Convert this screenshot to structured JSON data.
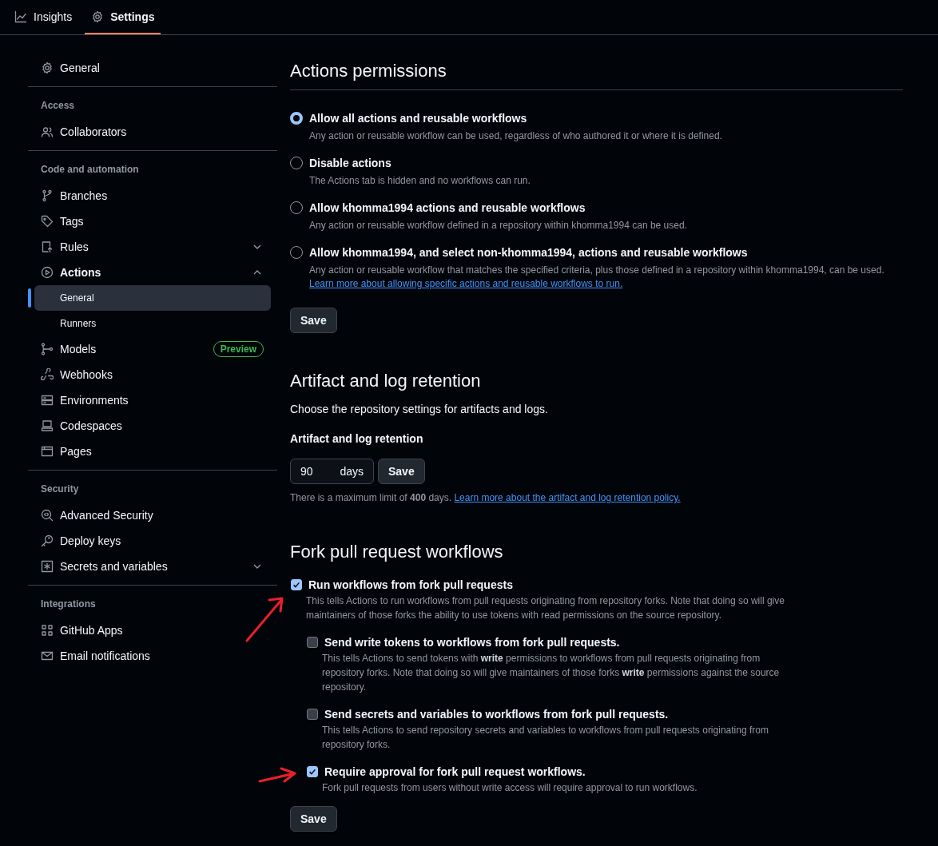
{
  "nav": {
    "tabs": [
      {
        "label": "Insights",
        "selected": false
      },
      {
        "label": "Settings",
        "selected": true
      }
    ]
  },
  "sidebar": {
    "sections": [
      {
        "items": [
          {
            "label": "General",
            "selected": false
          }
        ]
      },
      {
        "heading": "Access",
        "items": [
          {
            "label": "Collaborators",
            "selected": false
          }
        ]
      },
      {
        "heading": "Code and automation",
        "items": [
          {
            "label": "Branches",
            "selected": false
          },
          {
            "label": "Tags",
            "selected": false
          },
          {
            "label": "Rules",
            "selected": false,
            "expanded": false
          },
          {
            "label": "Actions",
            "selected": false,
            "expanded": true,
            "children": [
              {
                "label": "General",
                "selected": true
              },
              {
                "label": "Runners",
                "selected": false
              }
            ]
          },
          {
            "label": "Models",
            "selected": false,
            "badge": "Preview"
          },
          {
            "label": "Webhooks",
            "selected": false
          },
          {
            "label": "Environments",
            "selected": false
          },
          {
            "label": "Codespaces",
            "selected": false
          },
          {
            "label": "Pages",
            "selected": false
          }
        ]
      },
      {
        "heading": "Security",
        "items": [
          {
            "label": "Advanced Security",
            "selected": false
          },
          {
            "label": "Deploy keys",
            "selected": false
          },
          {
            "label": "Secrets and variables",
            "selected": false,
            "expanded": false
          }
        ]
      },
      {
        "heading": "Integrations",
        "items": [
          {
            "label": "GitHub Apps",
            "selected": false
          },
          {
            "label": "Email notifications",
            "selected": false
          }
        ]
      }
    ]
  },
  "permissions": {
    "title": "Actions permissions",
    "options": [
      {
        "label": "Allow all actions and reusable workflows",
        "description": "Any action or reusable workflow can be used, regardless of who authored it or where it is defined.",
        "selected": true
      },
      {
        "label": "Disable actions",
        "description": "The Actions tab is hidden and no workflows can run.",
        "selected": false
      },
      {
        "label": "Allow khomma1994 actions and reusable workflows",
        "description": "Any action or reusable workflow defined in a repository within khomma1994 can be used.",
        "selected": false
      },
      {
        "label": "Allow khomma1994, and select non-khomma1994, actions and reusable workflows",
        "description": "Any action or reusable workflow that matches the specified criteria, plus those defined in a repository within khomma1994, can be used.",
        "link": "Learn more about allowing specific actions and reusable workflows to run.",
        "selected": false
      }
    ],
    "save": "Save"
  },
  "retention": {
    "title": "Artifact and log retention",
    "description": "Choose the repository settings for artifacts and logs.",
    "field_label": "Artifact and log retention",
    "field": {
      "value": "90",
      "suffix": "days"
    },
    "save": "Save",
    "note": "There is a maximum limit of **400** days.",
    "link": "Learn more about the artifact and log retention policy."
  },
  "fork": {
    "title": "Fork pull request workflows",
    "options": [
      {
        "label": "Run workflows from fork pull requests",
        "description": "This tells Actions to run workflows from pull requests originating from repository forks. Note that doing so will give maintainers of those forks the ability to use tokens with read permissions on the source repository.",
        "checked": true,
        "children": [
          {
            "label": "Send write tokens to workflows from fork pull requests.",
            "description": "This tells Actions to send tokens with **write** permissions to workflows from pull requests originating from repository forks. Note that doing so will give maintainers of those forks **write** permissions against the source repository.",
            "checked": false
          },
          {
            "label": "Send secrets and variables to workflows from fork pull requests.",
            "description": "This tells Actions to send repository secrets and variables to workflows from pull requests originating from repository forks.",
            "checked": false
          },
          {
            "label": "Require approval for fork pull request workflows.",
            "description": "Fork pull requests from users without write access will require approval to run workflows.",
            "checked": true
          }
        ]
      }
    ],
    "save": "Save"
  }
}
